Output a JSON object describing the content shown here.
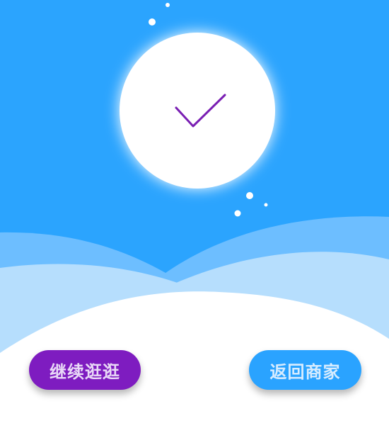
{
  "colors": {
    "sky": "#2ba4fe",
    "wave_mid": "#6dbeff",
    "wave_light": "#b6defd",
    "checkmark": "#7a1fb3",
    "continue_button": "#7e1cc0",
    "return_button": "#2aa3ff"
  },
  "success_badge": {
    "icon": "checkmark-icon"
  },
  "actions": {
    "continue_label": "继续逛逛",
    "return_label": "返回商家"
  }
}
